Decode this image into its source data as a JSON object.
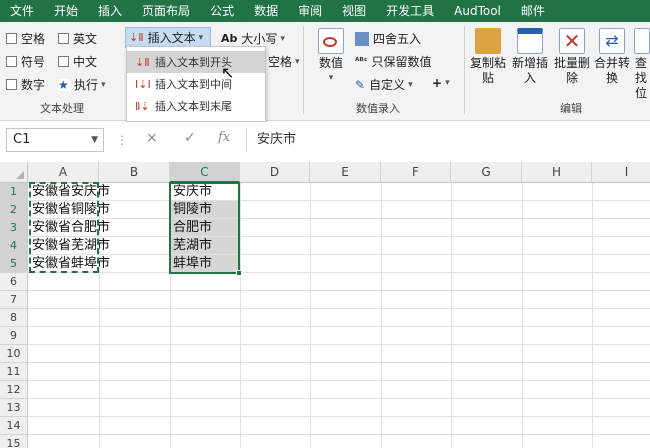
{
  "menubar": {
    "tabs": [
      "文件",
      "开始",
      "插入",
      "页面布局",
      "公式",
      "数据",
      "审阅",
      "视图",
      "开发工具",
      "AudTool",
      "邮件"
    ]
  },
  "ribbon": {
    "text_group": {
      "label": "文本处理",
      "checks": [
        "空格",
        "英文",
        "符号",
        "中文",
        "数字"
      ],
      "execute": "执行",
      "insert_text": "插入文本",
      "case": "大小写",
      "space": "空格"
    },
    "data_group": {
      "label": "数值录入",
      "value": "数值",
      "round": "四舍五入",
      "keep_value": "只保留数值",
      "custom": "自定义",
      "plus": "+"
    },
    "edit_group": {
      "label": "编辑",
      "copy_paste": "复制粘贴",
      "add_insert": "新增插入",
      "batch_delete": "批量删除",
      "merge_convert": "合并转换",
      "find": "查找位"
    }
  },
  "dropdown": {
    "items": [
      "插入文本到开头",
      "插入文本到中间",
      "插入文本到末尾"
    ]
  },
  "formula_bar": {
    "name_box": "C1",
    "cancel": "×",
    "confirm": "✓",
    "fx": "fx",
    "formula": "安庆市"
  },
  "grid": {
    "columns": [
      "A",
      "B",
      "C",
      "D",
      "E",
      "F",
      "G",
      "H",
      "I"
    ],
    "rows": [
      "1",
      "2",
      "3",
      "4",
      "5",
      "6",
      "7",
      "8",
      "9",
      "10",
      "11",
      "12",
      "13",
      "14",
      "15"
    ],
    "col_a": [
      "安徽省安庆市",
      "安徽省铜陵市",
      "安徽省合肥市",
      "安徽省芜湖市",
      "安徽省蚌埠市"
    ],
    "col_c": [
      "安庆市",
      "铜陵市",
      "合肥市",
      "芜湖市",
      "蚌埠市"
    ]
  },
  "colors": {
    "accent": "#217346"
  }
}
